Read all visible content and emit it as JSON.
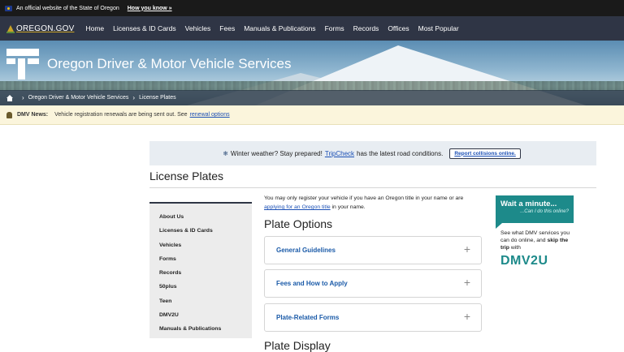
{
  "official_banner": {
    "text": "An official website of the State of Oregon",
    "how_link": "How you know »"
  },
  "topnav": {
    "logo": "OREGON.GOV",
    "items": [
      {
        "label": "Home"
      },
      {
        "label": "Licenses & ID Cards"
      },
      {
        "label": "Vehicles"
      },
      {
        "label": "Fees"
      },
      {
        "label": "Manuals & Publications"
      },
      {
        "label": "Forms"
      },
      {
        "label": "Records"
      },
      {
        "label": "Offices"
      },
      {
        "label": "Most Popular"
      }
    ]
  },
  "hero": {
    "title": "Oregon Driver & Motor Vehicle Services"
  },
  "breadcrumb": {
    "items": [
      "Oregon Driver & Motor Vehicle Services",
      "License Plates"
    ]
  },
  "news": {
    "label": "DMV News:",
    "text": "Vehicle registration renewals are being sent out. See",
    "link": "renewal options"
  },
  "alert": {
    "icon": "❄",
    "text_before": "Winter weather? Stay prepared!",
    "link": "TripCheck",
    "text_after": "has the latest road conditions.",
    "button": "Report collisions online."
  },
  "page": {
    "title": "License Plates"
  },
  "sidebar": {
    "items": [
      {
        "label": "About Us"
      },
      {
        "label": "Licenses & ID Cards"
      },
      {
        "label": "Vehicles"
      },
      {
        "label": "Forms"
      },
      {
        "label": "Records"
      },
      {
        "label": "50plus"
      },
      {
        "label": "Teen"
      },
      {
        "label": "DMV2U"
      },
      {
        "label": "Manuals & Publications"
      }
    ]
  },
  "main": {
    "intro_before": "You may only register your vehicle if you have an Oregon title in your name or are",
    "intro_link": "applying for an Oregon title",
    "intro_after": "in your name.",
    "plate_options_heading": "Plate Options",
    "accordions": [
      {
        "label": "General Guidelines",
        "icon": "+"
      },
      {
        "label": "Fees and How to Apply",
        "icon": "+"
      },
      {
        "label": "Plate-Related Forms",
        "icon": "+"
      }
    ],
    "plate_display_heading": "Plate Display"
  },
  "promo": {
    "headline": "Wait a minute...",
    "subhead": "...Can I do this online?",
    "body_before": "See what DMV services you can do online, and",
    "body_bold": "skip the trip",
    "body_after": "with",
    "brand": "DMV2U"
  },
  "colors": {
    "topnav_bg": "#2f3545",
    "news_bg": "#fbf5dc",
    "accent_link": "#1a4fb5",
    "promo_teal": "#1d8a8a"
  }
}
